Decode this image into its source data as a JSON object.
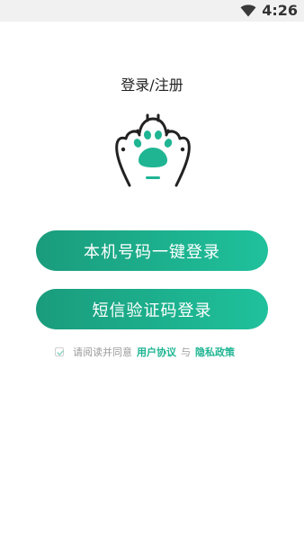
{
  "status_bar": {
    "time": "4:26",
    "icons": [
      "wifi-icon"
    ]
  },
  "page": {
    "title": "登录/注册"
  },
  "logo": {
    "icon": "paw-icon"
  },
  "buttons": {
    "one_click_login": "本机号码一键登录",
    "sms_login": "短信验证码登录"
  },
  "agreement": {
    "checked": true,
    "prefix": "请阅读并同意",
    "user_agreement": "用户协议",
    "conjunction": "与",
    "privacy_policy": "隐私政策"
  },
  "colors": {
    "gradient_start": "#1a9c7c",
    "gradient_end": "#1fc19c",
    "accent": "#1fb593",
    "paw_outline": "#222222",
    "paw_pad": "#1fb593"
  }
}
